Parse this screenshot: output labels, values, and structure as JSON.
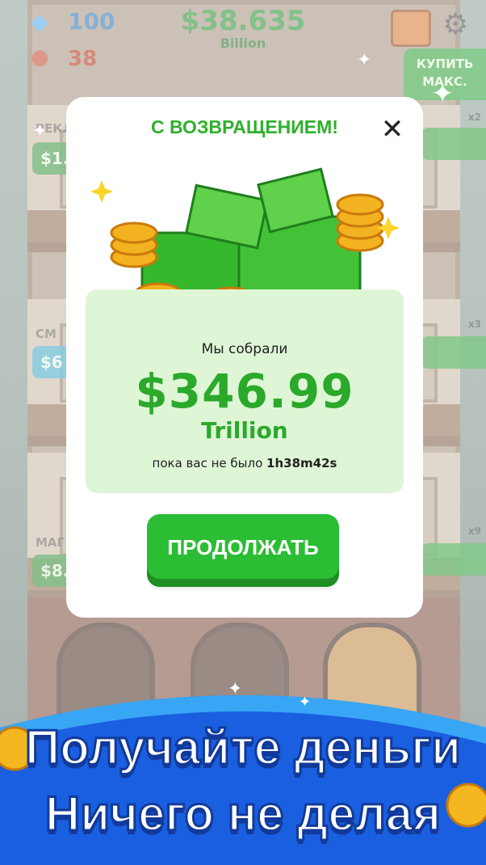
{
  "hud": {
    "gems": "100",
    "burgers": "38",
    "cash": "$38.635",
    "cash_unit": "Billion",
    "buy_max_label": "КУПИТЬ МАКС."
  },
  "background": {
    "floors": [
      {
        "label": "РЕКЛ",
        "price": "$1.",
        "multiplier": "x2"
      },
      {
        "label": "СМ",
        "price": "$6",
        "multiplier": "x3"
      },
      {
        "label": "МАГ",
        "price": "$8.",
        "multiplier": "x9"
      }
    ]
  },
  "modal": {
    "title": "С ВОЗВРАЩЕНИЕМ!",
    "collected_label": "Мы собрали",
    "collected_amount": "$346.99",
    "collected_unit": "Trillion",
    "away_prefix": "пока вас не было",
    "away_time": "1h38m42s",
    "continue_label": "ПРОДОЛЖАТЬ"
  },
  "banner": {
    "line1": "Получайте деньги",
    "line2": "Ничего не делая"
  },
  "colors": {
    "accent_green": "#2aa92b",
    "button_green": "#2bbd33",
    "banner_blue": "#1a5fe0"
  }
}
